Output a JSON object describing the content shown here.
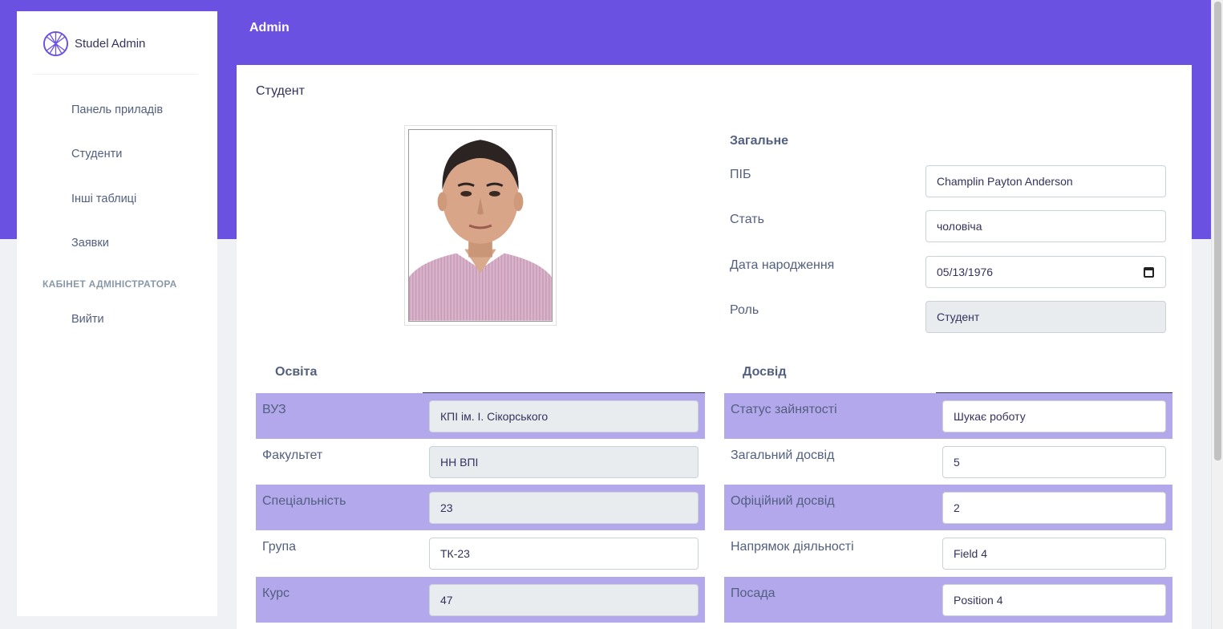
{
  "brand": {
    "name": "Studel Admin"
  },
  "sidebar": {
    "items": [
      {
        "label": "Панель приладів"
      },
      {
        "label": "Студенти"
      },
      {
        "label": "Інші таблиці"
      },
      {
        "label": "Заявки"
      }
    ],
    "section_heading": "КАБІНЕТ АДМІНІСТРАТОРА",
    "logout_label": "Вийти"
  },
  "header": {
    "title": "Admin"
  },
  "card": {
    "title": "Студент"
  },
  "general": {
    "heading": "Загальне",
    "full_name_label": "ПІБ",
    "full_name_value": "Champlin Payton Anderson",
    "gender_label": "Стать",
    "gender_value": "чоловіча",
    "birthdate_label": "Дата народження",
    "birthdate_value": "05/13/1976",
    "role_label": "Роль",
    "role_value": "Студент"
  },
  "education": {
    "heading": "Освіта",
    "rows": [
      {
        "label": "ВУЗ",
        "value": "КПІ ім. І. Сікорського"
      },
      {
        "label": "Факультет",
        "value": "НН ВПІ"
      },
      {
        "label": "Спеціальність",
        "value": "23"
      },
      {
        "label": "Група",
        "value": "ТК-23"
      },
      {
        "label": "Курс",
        "value": "47"
      }
    ]
  },
  "experience": {
    "heading": "Досвід",
    "rows": [
      {
        "label": "Статус зайнятості",
        "value": "Шукає роботу"
      },
      {
        "label": "Загальний досвід",
        "value": "5"
      },
      {
        "label": "Офіційний досвід",
        "value": "2"
      },
      {
        "label": "Напрямок діяльності",
        "value": "Field 4"
      },
      {
        "label": "Посада",
        "value": "Position 4"
      }
    ]
  },
  "colors": {
    "primary": "#6b51e2",
    "row_shade": "#b3a8ec",
    "disabled_input": "#e9ecef"
  }
}
